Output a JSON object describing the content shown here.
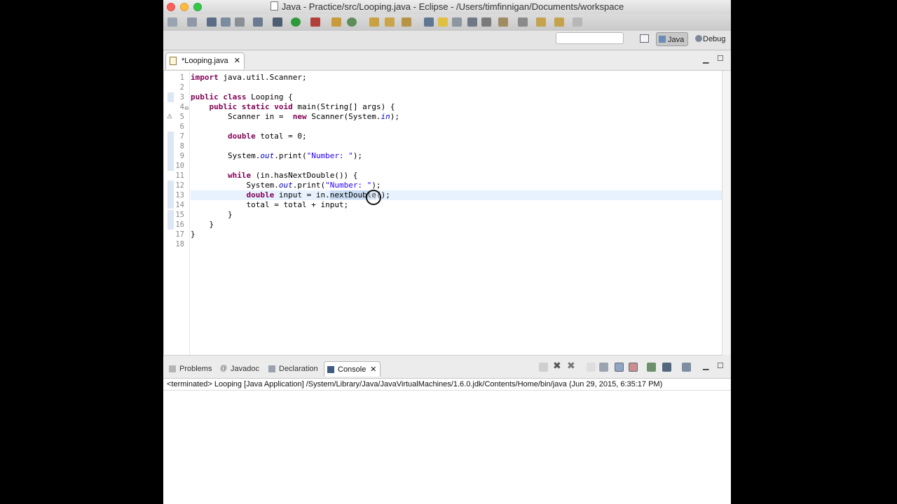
{
  "window": {
    "title": "Java - Practice/src/Looping.java - Eclipse - /Users/timfinnigan/Documents/workspace"
  },
  "toolbar": {
    "quick_access_value": ""
  },
  "perspectives": {
    "java_label": "Java",
    "debug_label": "Debug"
  },
  "editor": {
    "tab_label": "*Looping.java",
    "line_numbers": [
      "1",
      "2",
      "3",
      "4",
      "5",
      "6",
      "7",
      "8",
      "9",
      "10",
      "11",
      "12",
      "13",
      "14",
      "15",
      "16",
      "17",
      "18"
    ],
    "lines": {
      "l1": {
        "kw": "import",
        "rest": " java.util.Scanner;"
      },
      "l3": {
        "kw1": "public",
        "kw2": "class",
        "rest": " Looping {"
      },
      "l4": {
        "kw1": "public",
        "kw2": "static",
        "kw3": "void",
        "rest": " main(String[] args) {"
      },
      "l5": {
        "a": "Scanner in =  ",
        "kw": "new",
        "b": " Scanner(System.",
        "fld": "in",
        "c": ");"
      },
      "l7": {
        "kw": "double",
        "rest": " total = 0;"
      },
      "l9": {
        "a": "System.",
        "fld": "out",
        "b": ".print(",
        "str": "\"Number: \"",
        "c": ");"
      },
      "l11": {
        "kw": "while",
        "rest": " (in.hasNextDouble()) {"
      },
      "l12": {
        "a": "System.",
        "fld": "out",
        "b": ".print(",
        "str": "\"Number: \"",
        "c": ");"
      },
      "l13": {
        "kw": "double",
        "a": " input = in.",
        "sel": "nextDouble",
        "c": "();"
      },
      "l14": {
        "rest": "total = total + input;"
      },
      "l15": {
        "rest": "}"
      },
      "l16": {
        "rest": "}"
      },
      "l17": {
        "rest": "}"
      }
    }
  },
  "views": {
    "tabs": [
      "Problems",
      "Javadoc",
      "Declaration",
      "Console"
    ],
    "console_status": "<terminated> Looping [Java Application] /System/Library/Java/JavaVirtualMachines/1.6.0.jdk/Contents/Home/bin/java (Jun 29, 2015, 6:35:17 PM)"
  },
  "colors": {
    "keyword": "#7f0055",
    "string": "#2a00ff",
    "field": "#0000c0",
    "current_line": "#e8f2fe"
  }
}
